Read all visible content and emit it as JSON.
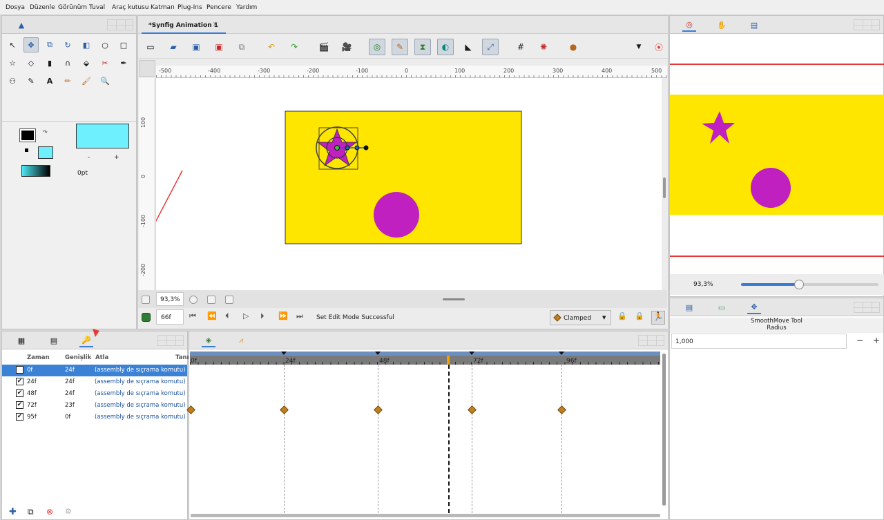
{
  "menubar": [
    "Dosya",
    "Düzenle",
    "Görünüm",
    "Tuval",
    "Araç kutusu",
    "Katman",
    "Plug-Ins",
    "Pencere",
    "Yardım"
  ],
  "document_tab": {
    "title": "*Synfig Animation 1",
    "close": "✕"
  },
  "ruler_h": [
    "-500",
    "-400",
    "-300",
    "-200",
    "-100",
    "0",
    "100",
    "200",
    "300",
    "400",
    "500"
  ],
  "ruler_v": [
    "100",
    "0",
    "-100",
    "-200"
  ],
  "canvas_status": {
    "zoom": "93,3%",
    "frame": "66f",
    "message": "Set Edit Mode Successful",
    "interpolation": "Clamped"
  },
  "toolbox": {
    "width_label": "0pt",
    "minus": "-",
    "plus": "+"
  },
  "navigator": {
    "zoom": "93,3%",
    "zoom_fraction": 0.42
  },
  "tool_options": {
    "title": "SmoothMove Tool",
    "param": "Radius",
    "value": "1,000",
    "minus": "−",
    "plus": "+"
  },
  "keyframes": {
    "headers": [
      "Zaman",
      "Genişlik",
      "Atla",
      "Tanı"
    ],
    "rows": [
      {
        "time": "0f",
        "length": "24f",
        "jump": "(assembly de sıçrama komutu)"
      },
      {
        "time": "24f",
        "length": "24f",
        "jump": "(assembly de sıçrama komutu)"
      },
      {
        "time": "48f",
        "length": "24f",
        "jump": "(assembly de sıçrama komutu)"
      },
      {
        "time": "72f",
        "length": "23f",
        "jump": "(assembly de sıçrama komutu)"
      },
      {
        "time": "95f",
        "length": "0f",
        "jump": "(assembly de sıçrama komutu)"
      }
    ]
  },
  "timetrack": {
    "labels": [
      "0f",
      "24f",
      "48f",
      "72f",
      "96f"
    ]
  },
  "colors": {
    "canvas_bg": "#ffe600",
    "shape": "#bf20bf",
    "accent": "#3a7bd5",
    "selection": "#3b82d6"
  }
}
